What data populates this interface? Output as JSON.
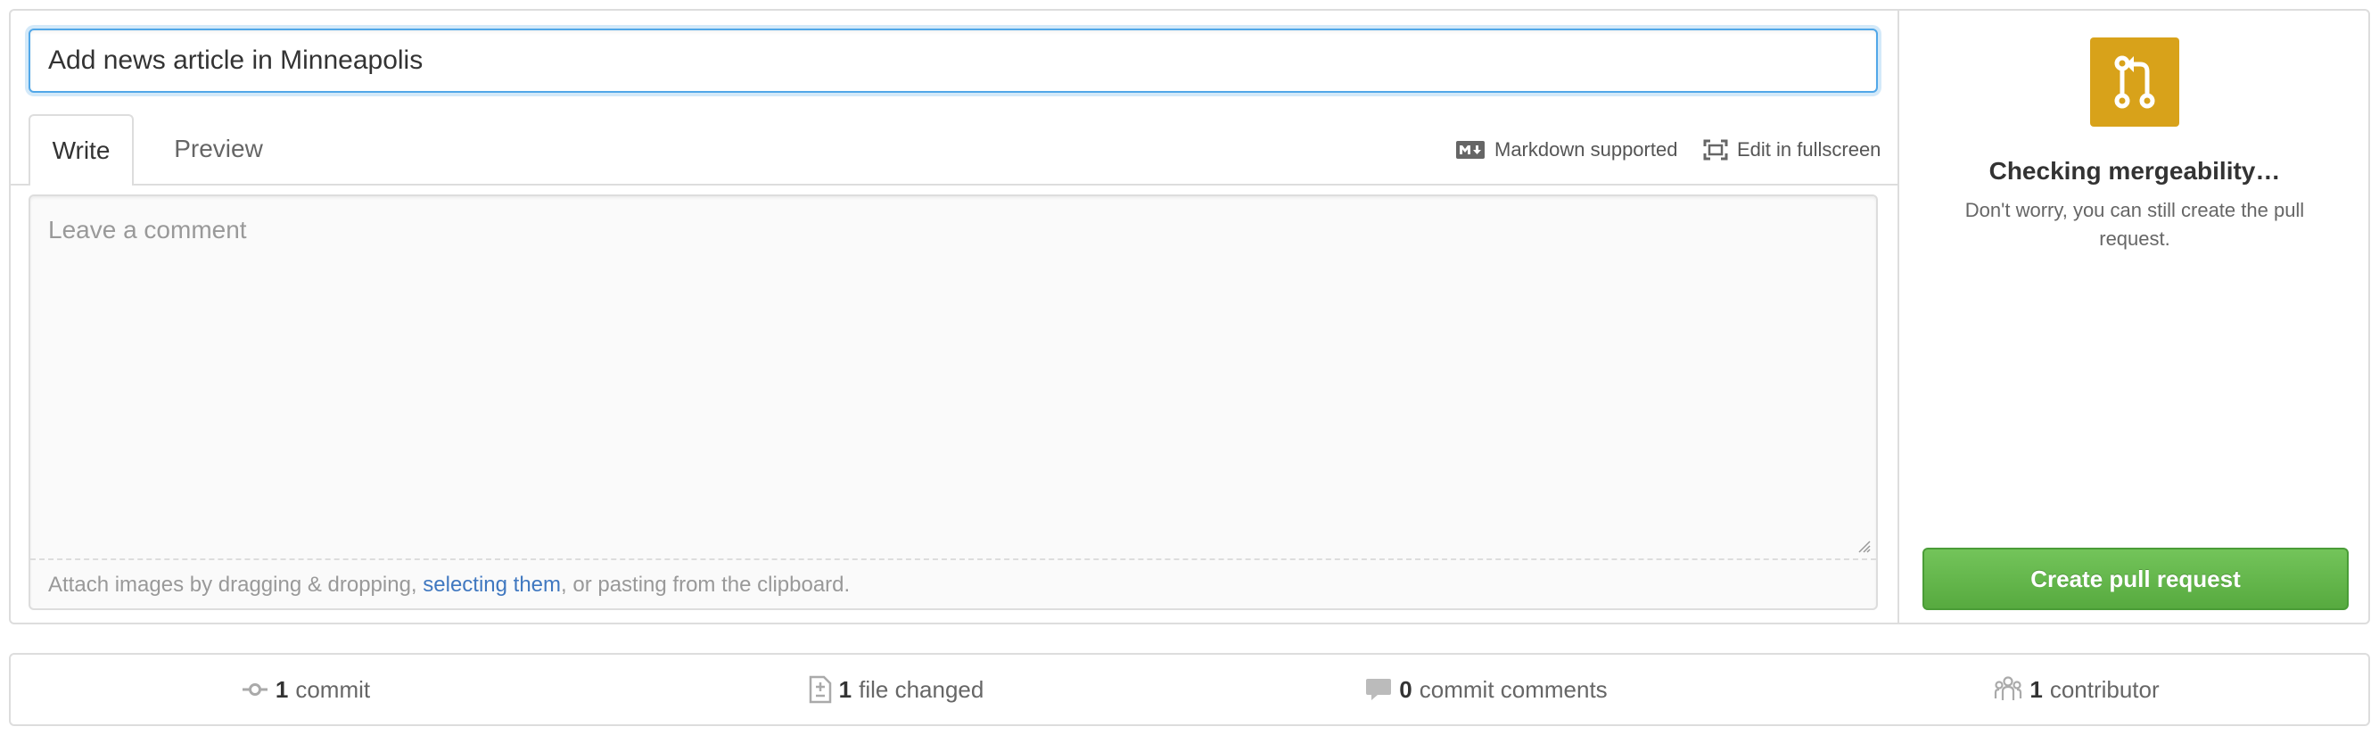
{
  "title_input": {
    "value": "Add news article in Minneapolis"
  },
  "tabs": [
    {
      "label": "Write"
    },
    {
      "label": "Preview"
    }
  ],
  "toolbar": {
    "markdown_label": "Markdown supported",
    "fullscreen_label": "Edit in fullscreen"
  },
  "comment": {
    "placeholder": "Leave a comment",
    "attach_prefix": "Attach images by dragging & dropping, ",
    "attach_link": "selecting them",
    "attach_suffix": ", or pasting from the clipboard."
  },
  "merge": {
    "title": "Checking mergeability…",
    "description": "Don't worry, you can still create the pull request.",
    "icon": "git-pull-request-icon",
    "icon_color": "#d8a21a"
  },
  "create_button": {
    "label": "Create pull request",
    "color": "#6cc644"
  },
  "summary": [
    {
      "icon": "git-commit-icon",
      "count": "1",
      "label": "commit"
    },
    {
      "icon": "file-diff-icon",
      "count": "1",
      "label": "file changed"
    },
    {
      "icon": "comment-icon",
      "count": "0",
      "label": "commit comments"
    },
    {
      "icon": "organization-icon",
      "count": "1",
      "label": "contributor"
    }
  ]
}
